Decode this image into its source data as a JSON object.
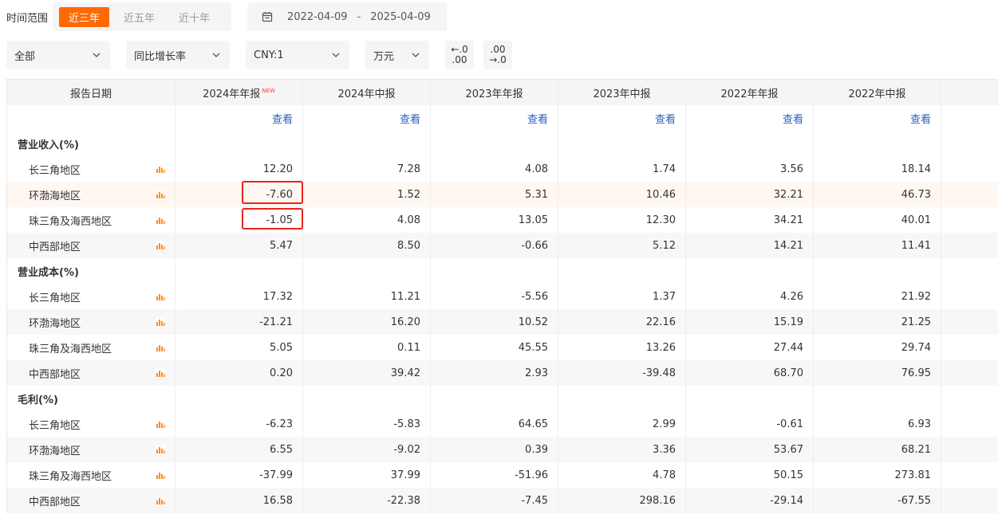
{
  "filters": {
    "range_label": "时间范围",
    "range_options": [
      "近三年",
      "近五年",
      "近十年"
    ],
    "date_start": "2022-04-09",
    "date_sep": "-",
    "date_end": "2025-04-09",
    "category": "全部",
    "metric": "同比增长率",
    "currency": "CNY:1",
    "unit": "万元",
    "decimal_decrease": [
      "←.0",
      ".00"
    ],
    "decimal_increase": [
      ".00",
      "→.0"
    ]
  },
  "table": {
    "header_first": "报告日期",
    "columns": [
      "2024年年报",
      "2024年中报",
      "2023年年报",
      "2023年中报",
      "2022年年报",
      "2022年中报"
    ],
    "new_badge": "NEW",
    "view_label": "查看",
    "sections": [
      {
        "title": "营业收入(%)",
        "rows": [
          {
            "name": "长三角地区",
            "values": [
              "12.20",
              "7.28",
              "4.08",
              "1.74",
              "3.56",
              "18.14"
            ]
          },
          {
            "name": "环渤海地区",
            "values": [
              "-7.60",
              "1.52",
              "5.31",
              "10.46",
              "32.21",
              "46.73"
            ]
          },
          {
            "name": "珠三角及海西地区",
            "values": [
              "-1.05",
              "4.08",
              "13.05",
              "12.30",
              "34.21",
              "40.01"
            ]
          },
          {
            "name": "中西部地区",
            "values": [
              "5.47",
              "8.50",
              "-0.66",
              "5.12",
              "14.21",
              "11.41"
            ]
          }
        ]
      },
      {
        "title": "营业成本(%)",
        "rows": [
          {
            "name": "长三角地区",
            "values": [
              "17.32",
              "11.21",
              "-5.56",
              "1.37",
              "4.26",
              "21.92"
            ]
          },
          {
            "name": "环渤海地区",
            "values": [
              "-21.21",
              "16.20",
              "10.52",
              "22.16",
              "15.19",
              "21.25"
            ]
          },
          {
            "name": "珠三角及海西地区",
            "values": [
              "5.05",
              "0.11",
              "45.55",
              "13.26",
              "27.44",
              "29.74"
            ]
          },
          {
            "name": "中西部地区",
            "values": [
              "0.20",
              "39.42",
              "2.93",
              "-39.48",
              "68.70",
              "76.95"
            ]
          }
        ]
      },
      {
        "title": "毛利(%)",
        "rows": [
          {
            "name": "长三角地区",
            "values": [
              "-6.23",
              "-5.83",
              "64.65",
              "2.99",
              "-0.61",
              "6.93"
            ]
          },
          {
            "name": "环渤海地区",
            "values": [
              "6.55",
              "-9.02",
              "0.39",
              "3.36",
              "53.67",
              "68.21"
            ]
          },
          {
            "name": "珠三角及海西地区",
            "values": [
              "-37.99",
              "37.99",
              "-51.96",
              "4.78",
              "50.15",
              "273.81"
            ]
          },
          {
            "name": "中西部地区",
            "values": [
              "16.58",
              "-22.38",
              "-7.45",
              "298.16",
              "-29.14",
              "-67.55"
            ]
          }
        ]
      }
    ]
  },
  "colors": {
    "accent": "#ff6a00",
    "link": "#2a5fc0",
    "highlight_box": "#e8231f"
  }
}
